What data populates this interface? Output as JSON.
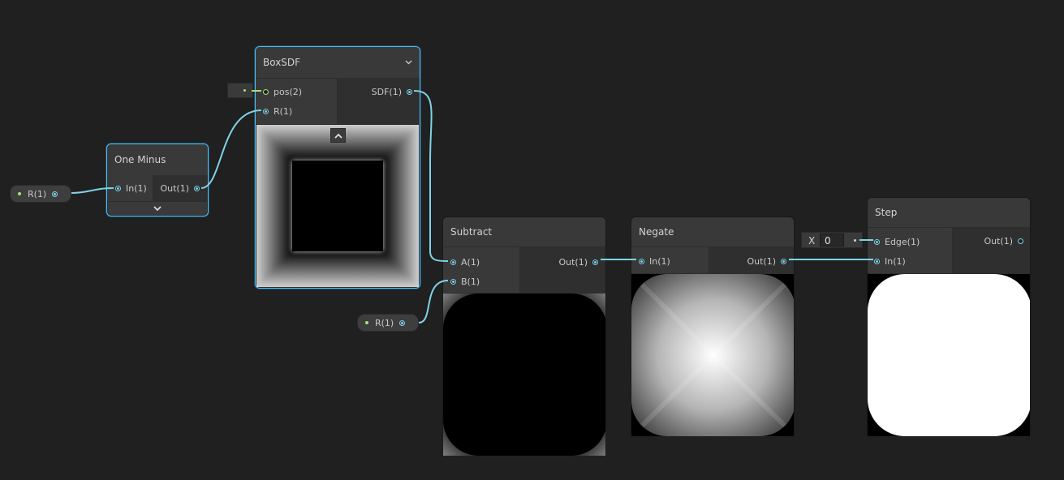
{
  "nodes": {
    "one_minus": {
      "title": "One Minus",
      "in": "In(1)",
      "out": "Out(1)"
    },
    "boxsdf": {
      "title": "BoxSDF",
      "in_pos": "pos(2)",
      "in_r": "R(1)",
      "out": "SDF(1)"
    },
    "subtract": {
      "title": "Subtract",
      "in_a": "A(1)",
      "in_b": "B(1)",
      "out": "Out(1)"
    },
    "negate": {
      "title": "Negate",
      "in": "In(1)",
      "out": "Out(1)"
    },
    "step": {
      "title": "Step",
      "in_edge": "Edge(1)",
      "in": "In(1)",
      "out": "Out(1)",
      "edge_axis": "X",
      "edge_value": "0"
    }
  },
  "properties": {
    "r_left": "R(1)",
    "r_bottom": "R(1)"
  },
  "colors": {
    "background": "#202020",
    "wire": "#7fd3e6",
    "selection": "#44c0ff",
    "vec2_port": "#a8e07a"
  },
  "icons": {
    "boxsdf_collapse": "chevron-down-icon",
    "one_minus_expand": "chevron-down-icon",
    "preview_toggle": "chevron-up-icon"
  }
}
